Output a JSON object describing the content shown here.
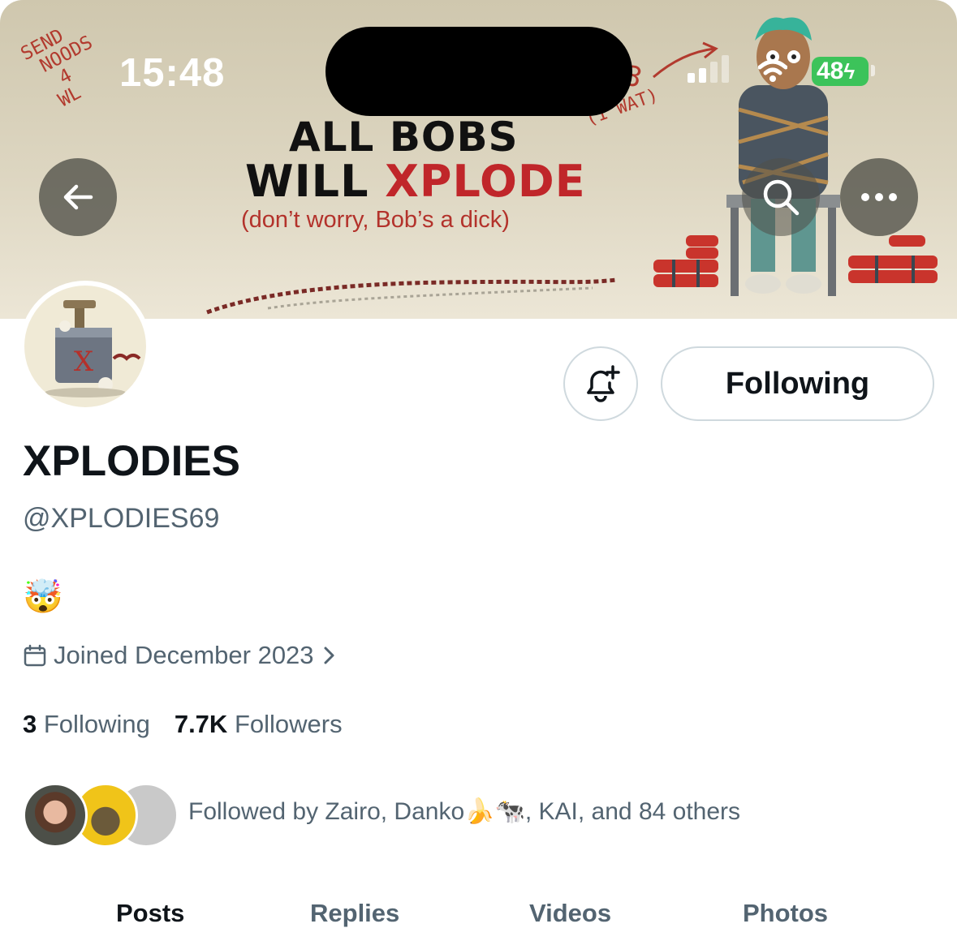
{
  "status_bar": {
    "time": "15:48",
    "battery": "48",
    "battery_color": "#3cc35a"
  },
  "banner": {
    "handwriting_left": "SEND\n NOODS\n  4\n WL",
    "handwriting_right": "(1 WAT)",
    "handwriting_number": "3",
    "title_line1": "ALL BOBS",
    "title_line2_a": "WILL ",
    "title_line2_b": "XPLODE",
    "subtitle": "(don’t worry, Bob’s a dick)",
    "accent_color": "#c0262a"
  },
  "nav": {
    "back_icon": "arrow-left-icon",
    "search_icon": "search-icon",
    "more_icon": "more-horizontal-icon"
  },
  "profile": {
    "display_name": "XPLODIES",
    "handle": "@XPLODIES69",
    "bio": "🤯",
    "joined": "Joined December 2023",
    "following_count": "3",
    "following_label": "Following",
    "followers_count": "7.7K",
    "followers_label": "Followers",
    "followed_by": "Followed by Zairo, Danko🍌🐄, KAI, and 84 others"
  },
  "actions": {
    "notify_icon": "bell-plus-icon",
    "following_button": "Following"
  },
  "tabs": [
    {
      "label": "Posts",
      "active": true
    },
    {
      "label": "Replies",
      "active": false
    },
    {
      "label": "Videos",
      "active": false
    },
    {
      "label": "Photos",
      "active": false
    }
  ]
}
